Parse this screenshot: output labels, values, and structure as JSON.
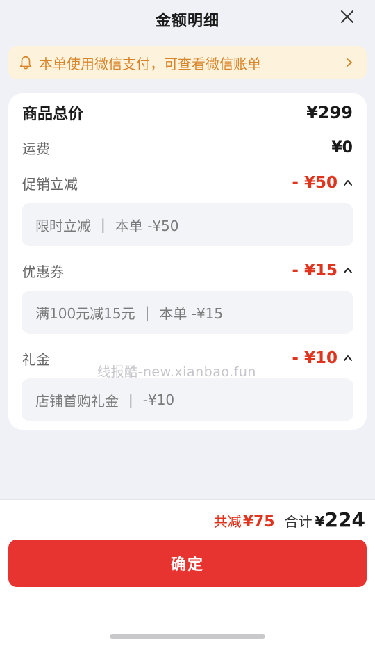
{
  "header": {
    "title": "金额明细",
    "close_icon": "close-icon"
  },
  "notice": {
    "icon": "bell-icon",
    "text": "本单使用微信支付，可查看微信账单",
    "chevron": "chevron-right-icon",
    "color": "#d98428",
    "background": "#fdf3dc"
  },
  "breakdown": {
    "goods_total": {
      "label": "商品总价",
      "value": "¥299"
    },
    "shipping": {
      "label": "运费",
      "value": "¥0"
    },
    "promotion": {
      "label": "促销立减",
      "value": "- ¥50",
      "detail_name": "限时立减",
      "detail_sep": "|",
      "detail_value": "本单 -¥50"
    },
    "coupon": {
      "label": "优惠券",
      "value": "- ¥15",
      "detail_name": "满100元减15元",
      "detail_sep": "|",
      "detail_value": "本单 -¥15"
    },
    "gift": {
      "label": "礼金",
      "value": "- ¥10",
      "detail_name": "店铺首购礼金",
      "detail_sep": "|",
      "detail_value": "-¥10"
    }
  },
  "watermark": "线报酷-new.xianbao.fun",
  "footer": {
    "saved_label": "共减",
    "saved_value": "¥75",
    "total_label": "合计",
    "total_currency": "¥",
    "total_value": "224",
    "confirm_label": "确定"
  },
  "colors": {
    "discount": "#e0341f",
    "confirm_button": "#e83431",
    "page_background": "#f0f1f6"
  }
}
